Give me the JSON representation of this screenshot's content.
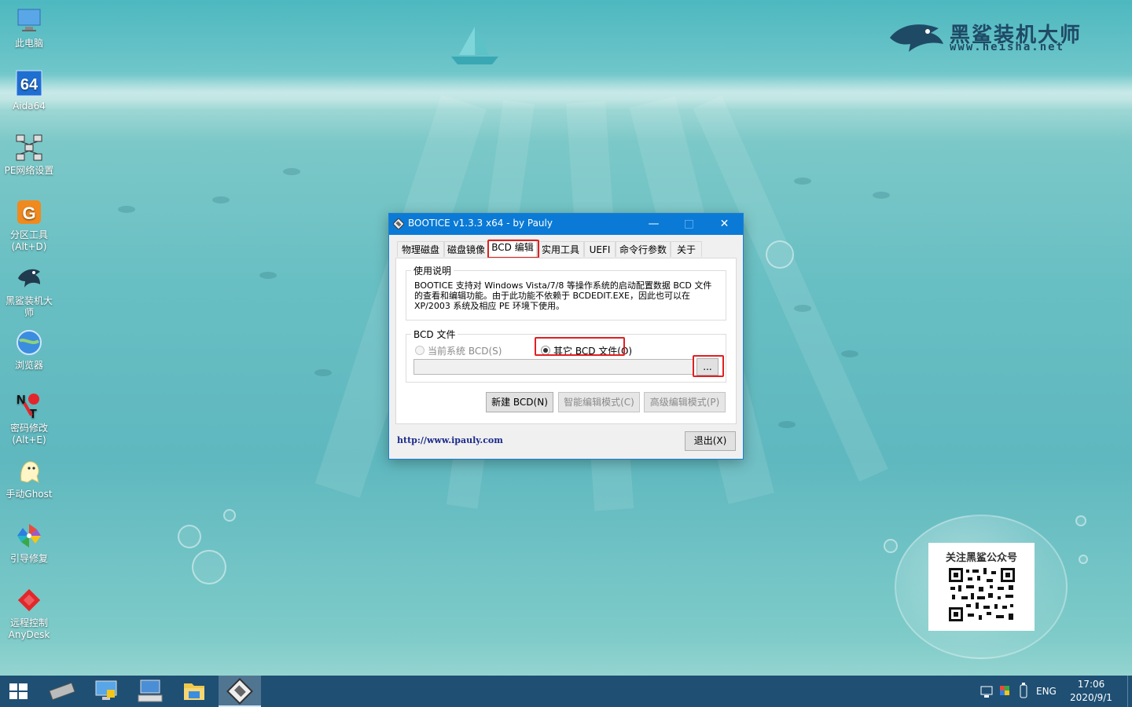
{
  "desktop": {
    "brand": {
      "title": "黑鲨装机大师",
      "url": "www.heisha.net"
    },
    "icons": [
      {
        "label": "此电脑",
        "icon": "computer-icon"
      },
      {
        "label": "Aida64",
        "icon": "aida64-icon"
      },
      {
        "label": "PE网络设置",
        "icon": "network-icon"
      },
      {
        "label": "分区工具\n(Alt+D)",
        "icon": "partition-icon"
      },
      {
        "label": "黑鲨装机大\n师",
        "icon": "shark-icon"
      },
      {
        "label": "浏览器",
        "icon": "browser-icon"
      },
      {
        "label": "密码修改\n(Alt+E)",
        "icon": "password-icon"
      },
      {
        "label": "手动Ghost",
        "icon": "ghost-icon"
      },
      {
        "label": "引导修复",
        "icon": "pinwheel-icon"
      },
      {
        "label": "远程控制\nAnyDesk",
        "icon": "anydesk-icon"
      }
    ],
    "qr": {
      "title": "关注黑鲨公众号"
    }
  },
  "window": {
    "title": "BOOTICE v1.3.3 x64 - by Pauly",
    "tabs": [
      "物理磁盘",
      "磁盘镜像",
      "BCD 编辑",
      "实用工具",
      "UEFI",
      "命令行参数",
      "关于"
    ],
    "active_tab": "BCD 编辑",
    "usage": {
      "legend": "使用说明",
      "text": "BOOTICE 支持对 Windows Vista/7/8 等操作系统的启动配置数据 BCD 文件的查看和编辑功能。由于此功能不依赖于 BCDEDIT.EXE，因此也可以在 XP/2003 系统及相应 PE 环境下使用。"
    },
    "bcd": {
      "legend": "BCD 文件",
      "radio_current": "当前系统 BCD(S)",
      "radio_other": "其它 BCD 文件(O)",
      "selected": "other",
      "path_value": "",
      "browse_label": "..."
    },
    "buttons": {
      "new_bcd": "新建 BCD(N)",
      "smart_edit": "智能编辑模式(C)",
      "advanced_edit": "高级编辑模式(P)"
    },
    "link": "http://www.ipauly.com",
    "exit_label": "退出(X)"
  },
  "taskbar": {
    "tray": {
      "lang": "ENG",
      "time": "17:06",
      "date": "2020/9/1"
    }
  }
}
